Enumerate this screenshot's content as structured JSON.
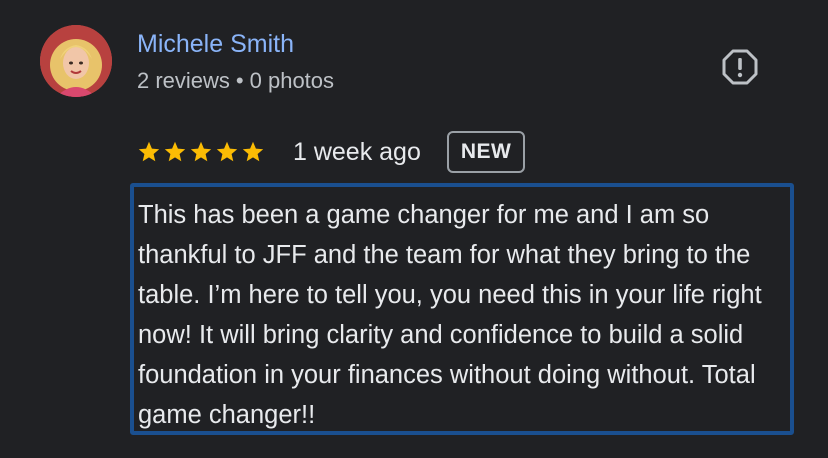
{
  "reviewer": {
    "name": "Michele Smith",
    "reviews_count": "2 reviews",
    "separator": "•",
    "photos_count": "0 photos"
  },
  "review": {
    "rating": 5,
    "max_rating": 5,
    "time_ago": "1 week ago",
    "badge": "NEW",
    "text": "This has been a game changer for me and I am so thankful to JFF and the team for what they bring to the table. I’m here to tell you, you need this in your life right now! It will bring clarity and confidence to build a solid foundation in your finances without doing without. Total game changer!!"
  },
  "icons": {
    "report": "report-flag-icon",
    "star": "star-icon"
  },
  "colors": {
    "background": "#202124",
    "name_link": "#8ab4f8",
    "star": "#fbbc04",
    "highlight_border": "#1a4f8f"
  }
}
